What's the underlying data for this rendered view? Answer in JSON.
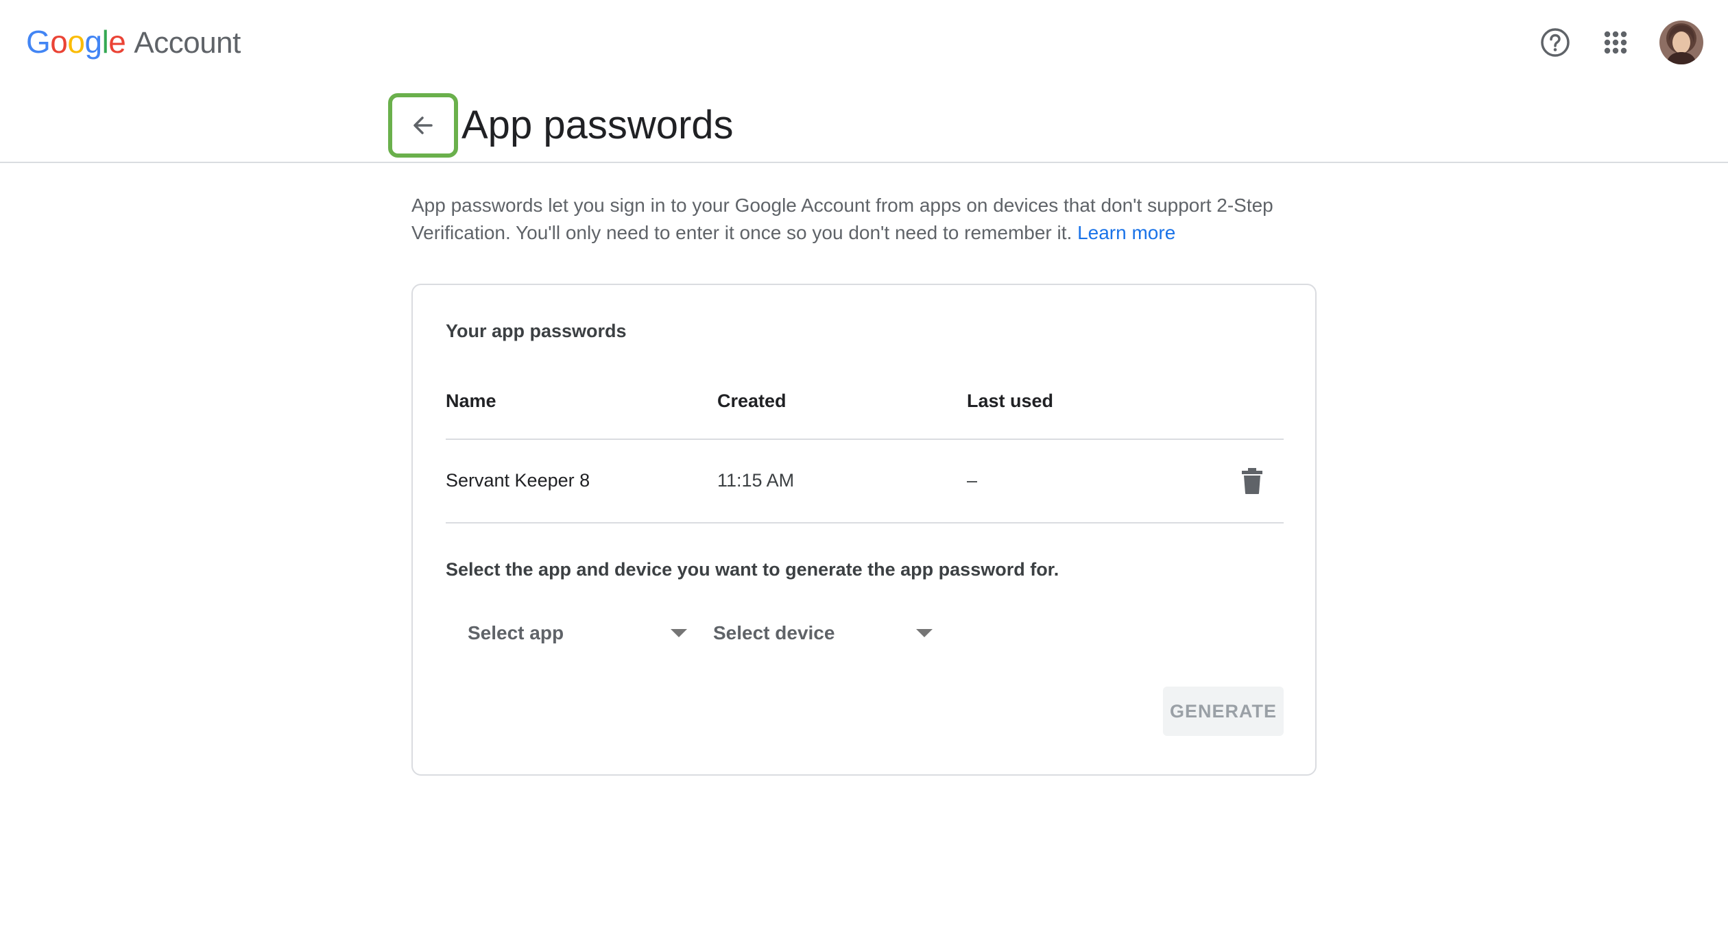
{
  "header": {
    "logo_letters": [
      "G",
      "o",
      "o",
      "g",
      "l",
      "e"
    ],
    "product_name": "Account",
    "help_icon": "help-circle-icon",
    "apps_icon": "apps-grid-icon",
    "avatar": "user-avatar"
  },
  "page": {
    "back_icon": "arrow-left-icon",
    "title": "App passwords",
    "description": "App passwords let you sign in to your Google Account from apps on devices that don't support 2-Step Verification. You'll only need to enter it once so you don't need to remember it.",
    "learn_more": "Learn more"
  },
  "card": {
    "title": "Your app passwords",
    "columns": {
      "name": "Name",
      "created": "Created",
      "last_used": "Last used"
    },
    "rows": [
      {
        "name": "Servant Keeper 8",
        "created": "11:15 AM",
        "last_used": "–",
        "action_icon": "trash-icon"
      }
    ],
    "instruction": "Select the app and device you want to generate the app password for.",
    "select_app": "Select app",
    "select_device": "Select device",
    "generate_label": "GENERATE"
  },
  "colors": {
    "back_highlight": "#6ab04c",
    "link": "#1a73e8",
    "divider": "#dadce0"
  }
}
